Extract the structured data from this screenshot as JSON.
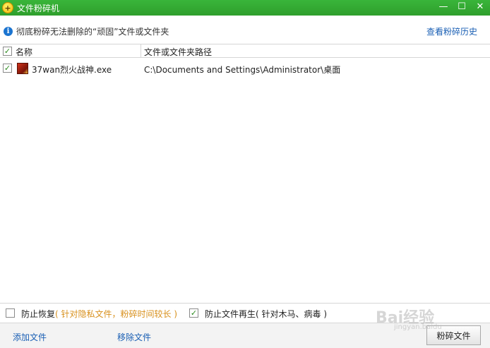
{
  "window": {
    "title": "文件粉碎机",
    "buttons": [
      "minimize",
      "maximize",
      "close"
    ]
  },
  "info": {
    "text": "彻底粉碎无法删除的“顽固”文件或文件夹",
    "history_link": "查看粉碎历史"
  },
  "table": {
    "columns": [
      "名称",
      "文件或文件夹路径"
    ],
    "header_checked": true,
    "rows": [
      {
        "checked": true,
        "name": "37wan烈火战神.exe",
        "path": "C:\\Documents and Settings\\Administrator\\桌面"
      }
    ]
  },
  "options": {
    "prevent_recovery": {
      "checked": false,
      "label": "防止恢复",
      "note": "( 针对隐私文件，粉碎时间较长 )"
    },
    "prevent_regen": {
      "checked": true,
      "label": "防止文件再生",
      "note": "( 针对木马、病毒 )"
    }
  },
  "bottom": {
    "add_file": "添加文件",
    "remove_file": "移除文件",
    "shred_button": "粉碎文件"
  },
  "watermark": {
    "text": "Bai经验",
    "sub": "jingyan.baidu"
  },
  "colors": {
    "titlebar": "#2f9f2c",
    "link": "#1a5fb4",
    "note": "#d8901c"
  }
}
